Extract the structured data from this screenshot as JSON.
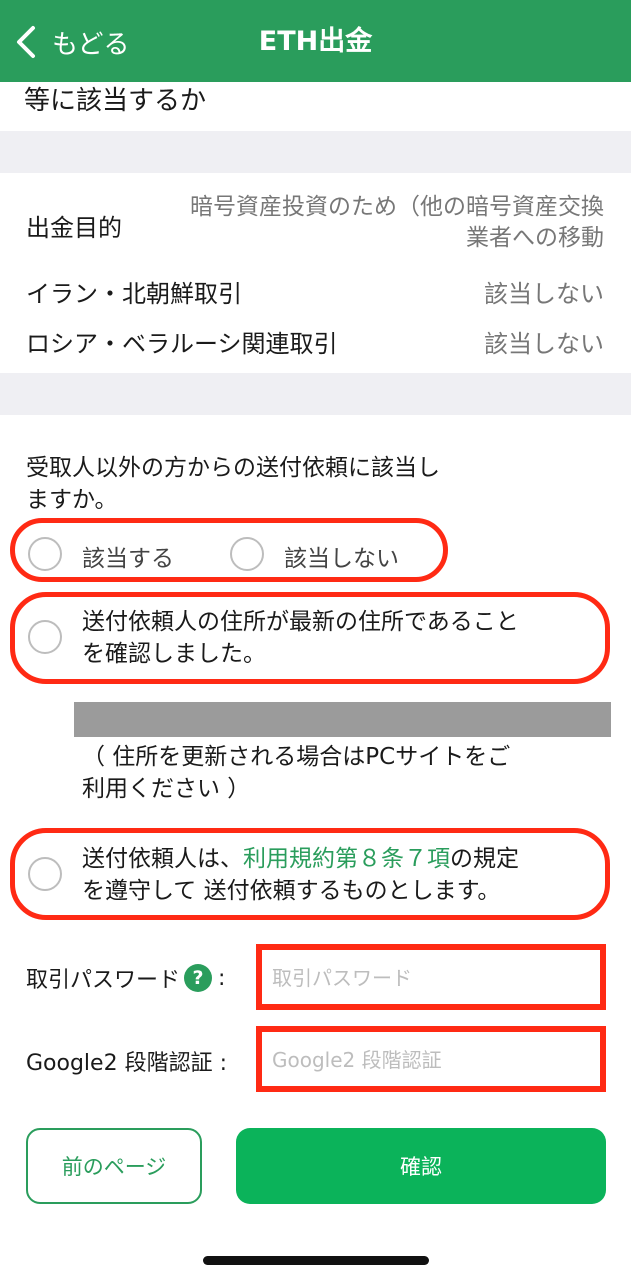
{
  "header": {
    "back_label": "もどる",
    "title": "ETH出金"
  },
  "prev_section_tail": "等に該当するか",
  "details": {
    "purpose_label": "出金目的",
    "purpose_value_line1": "暗号資産投資のため（他の暗号資産交換",
    "purpose_value_line2": "業者への移動",
    "iran_label": "イラン・北朝鮮取引",
    "iran_value": "該当しない",
    "russia_label": "ロシア・ベラルーシ関連取引",
    "russia_value": "該当しない"
  },
  "question": {
    "line1": "受取人以外の方からの送付依頼に該当し",
    "line2": "ますか。",
    "option_yes": "該当する",
    "option_no": "該当しない"
  },
  "confirm_address": {
    "line1": "送付依頼人の住所が最新の住所であること",
    "line2": "を確認しました。"
  },
  "address_note": {
    "line1": "（ 住所を更新される場合はPCサイトをご",
    "line2": "利用ください ）"
  },
  "terms": {
    "prefix": "送付依頼人は、",
    "link": "利用規約第８条７項",
    "suffix": "の規定",
    "line2": "を遵守して 送付依頼するものとします。"
  },
  "fields": {
    "password_label": "取引パスワード",
    "password_colon": ":",
    "help_mark": "?",
    "password_placeholder": "取引パスワード",
    "google_label": "Google2 段階認証 :",
    "google_placeholder": "Google2 段階認証"
  },
  "buttons": {
    "prev": "前のページ",
    "confirm": "確認"
  },
  "colors": {
    "brand_green": "#2a9d5c",
    "button_green": "#0bb35a",
    "highlight_red": "#ff2a14"
  }
}
